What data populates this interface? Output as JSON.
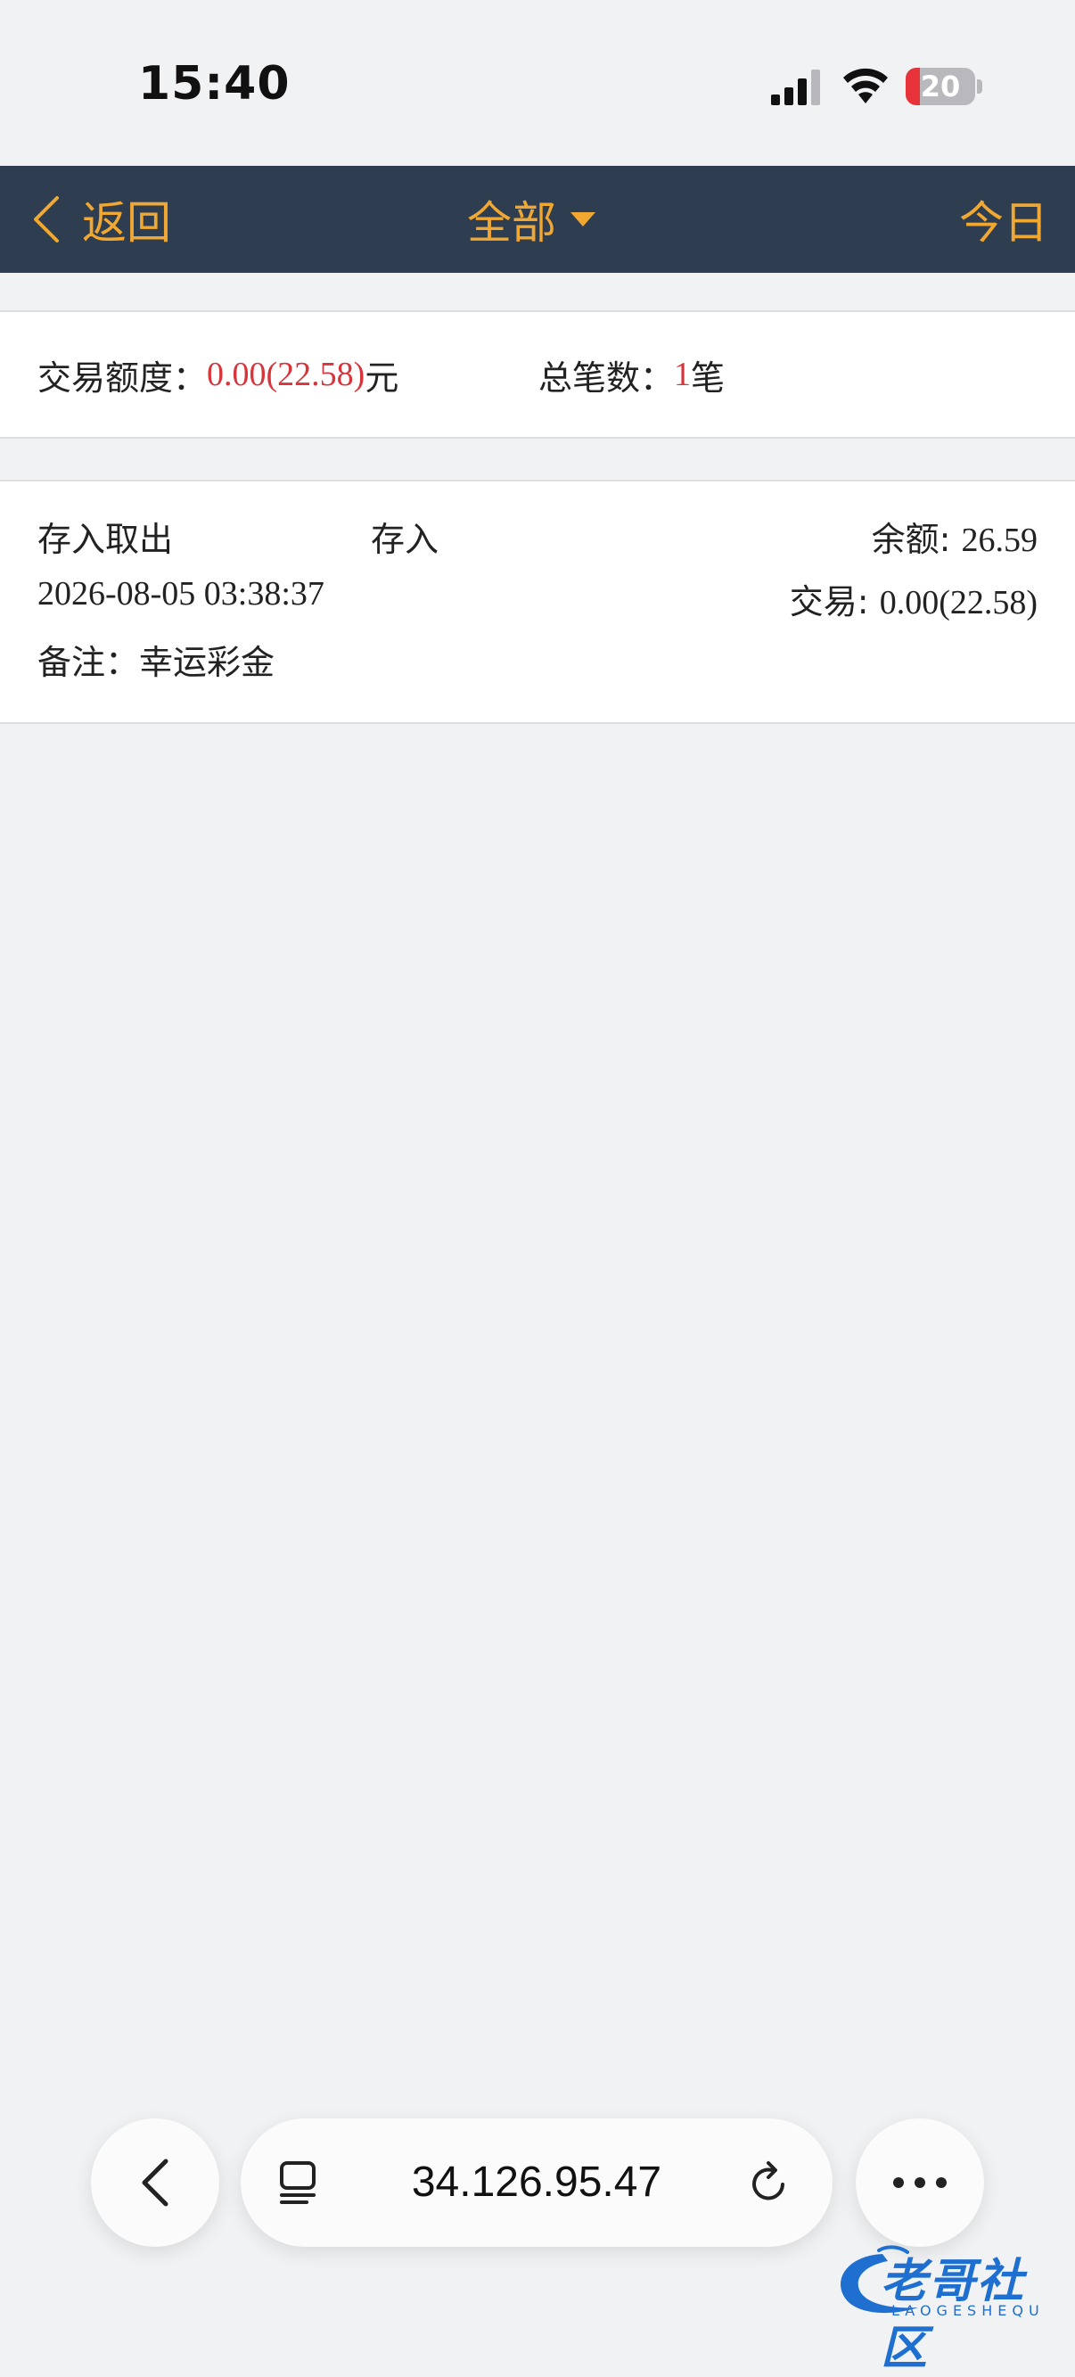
{
  "status_bar": {
    "time": "15:40",
    "battery_level": "20",
    "battery_fraction": 0.2,
    "battery_color": "#e8323a"
  },
  "navbar": {
    "back_label": "返回",
    "title": "全部",
    "today_label": "今日",
    "accent_color": "#f0a832",
    "background": "#2e3d50"
  },
  "summary": {
    "amount_label": "交易额度：",
    "amount_value": "0.00(22.58)",
    "amount_unit": "元",
    "count_label": "总笔数：",
    "count_value": "1",
    "count_unit": "笔",
    "highlight_color": "#d8343b"
  },
  "records": [
    {
      "category": "存入取出",
      "type": "存入",
      "balance_label": "余额: ",
      "balance": "26.59",
      "datetime": "2026-08-05 03:38:37",
      "trade_label": "交易: ",
      "trade": "0.00(22.58)",
      "note_label": "备注：",
      "note": "幸运彩金"
    }
  ],
  "browser": {
    "url": "34.126.95.47",
    "back_icon": "chevron-left-icon",
    "tabs_icon": "tabs-icon",
    "reload_icon": "reload-icon",
    "more_icon": "more-icon"
  },
  "watermark": {
    "text": "老哥社区",
    "subtext": "LAOGESHEQU"
  }
}
